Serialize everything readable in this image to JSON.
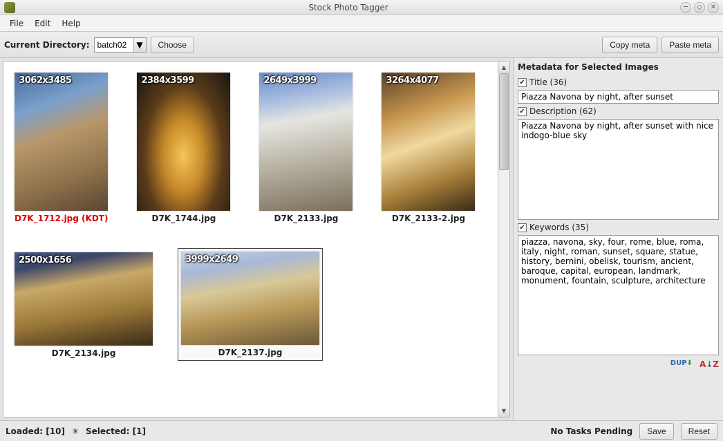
{
  "window": {
    "title": "Stock Photo Tagger"
  },
  "menu": {
    "file": "File",
    "edit": "Edit",
    "help": "Help"
  },
  "toolbar": {
    "current_dir_label": "Current Directory:",
    "combo_value": "batch02",
    "choose": "Choose",
    "copy_meta": "Copy meta",
    "paste_meta": "Paste meta"
  },
  "thumbs": [
    {
      "dim": "3062x3485",
      "label": "D7K_1712.jpg (KDT)",
      "dup": true,
      "orient": "portrait",
      "img": "img-ruins",
      "selected": false
    },
    {
      "dim": "2384x3599",
      "label": "D7K_1744.jpg",
      "dup": false,
      "orient": "portrait",
      "img": "img-colosseum",
      "selected": false
    },
    {
      "dim": "2649x3999",
      "label": "D7K_2133.jpg",
      "dup": false,
      "orient": "portrait",
      "img": "img-fountain1",
      "selected": false
    },
    {
      "dim": "3264x4077",
      "label": "D7K_2133-2.jpg",
      "dup": false,
      "orient": "portrait",
      "img": "img-fountain2",
      "selected": false
    },
    {
      "dim": "2500x1656",
      "label": "D7K_2134.jpg",
      "dup": false,
      "orient": "landscape",
      "img": "img-piazza1",
      "selected": false
    },
    {
      "dim": "3999x2649",
      "label": "D7K_2137.jpg",
      "dup": false,
      "orient": "landscape",
      "img": "img-piazza2",
      "selected": true
    }
  ],
  "sidebar": {
    "heading": "Metadata for Selected Images",
    "title_label": "Title (36)",
    "title_value": "Piazza Navona by night, after sunset",
    "desc_label": "Description (62)",
    "desc_value": "Piazza Navona by night, after sunset with nice indogo-blue sky",
    "kw_label": "Keywords (35)",
    "kw_value": "piazza, navona, sky, four, rome, blue, roma, italy, night, roman, sunset, square, statue, history, bernini, obelisk, tourism, ancient, baroque, capital, european, landmark, monument, fountain, sculpture, architecture"
  },
  "status": {
    "loaded": "Loaded: [10]",
    "star": "✳",
    "selected": "Selected: [1]",
    "tasks": "No Tasks Pending",
    "save": "Save",
    "reset": "Reset"
  }
}
